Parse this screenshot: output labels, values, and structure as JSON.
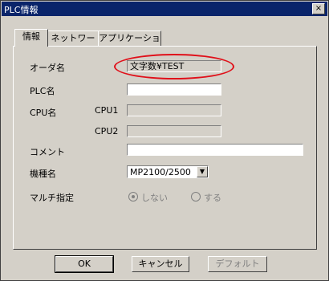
{
  "window": {
    "title": "PLC情報",
    "close_label": "×"
  },
  "tabs": [
    {
      "label": "情報",
      "active": true
    },
    {
      "label": "ネットワーク",
      "active": false
    },
    {
      "label": "アプリケーション",
      "active": false
    }
  ],
  "form": {
    "order_name": {
      "label": "オーダ名",
      "value": "文字数¥TEST"
    },
    "plc_name": {
      "label": "PLC名",
      "value": ""
    },
    "cpu_name": {
      "label": "CPU名",
      "cpu1_label": "CPU1",
      "cpu1_value": "",
      "cpu2_label": "CPU2",
      "cpu2_value": ""
    },
    "comment": {
      "label": "コメント",
      "value": ""
    },
    "model": {
      "label": "機種名",
      "value": "MP2100/2500"
    },
    "multi": {
      "label": "マルチ指定",
      "option_no": "しない",
      "option_yes": "する",
      "selected": "しない"
    }
  },
  "buttons": {
    "ok": "OK",
    "cancel": "キャンセル",
    "default": "デフォルト"
  },
  "colors": {
    "titlebar": "#0a246a",
    "highlight": "#e0101a"
  }
}
